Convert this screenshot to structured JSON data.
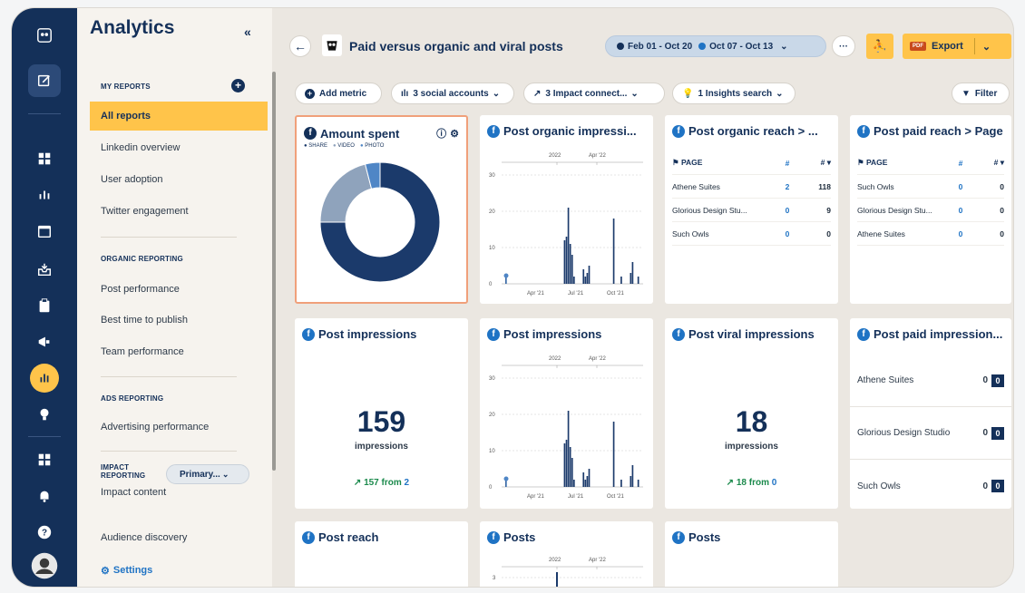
{
  "sidebar": {
    "title": "Analytics",
    "collapse": "«",
    "my_reports": "MY REPORTS",
    "items_my": [
      "All reports",
      "Linkedin overview",
      "User adoption",
      "Twitter engagement"
    ],
    "organic_h": "ORGANIC REPORTING",
    "items_organic": [
      "Post performance",
      "Best time to publish",
      "Team performance"
    ],
    "ads_h": "ADS REPORTING",
    "items_ads": [
      "Advertising performance"
    ],
    "impact_h1": "IMPACT",
    "impact_h2": "REPORTING",
    "impact_select": "Primary... ",
    "items_impact": [
      "Impact content",
      "Audience discovery"
    ],
    "settings": "Settings"
  },
  "header": {
    "title": "Paid versus organic and viral posts",
    "date_range": "Feb 01 - Oct 20",
    "compare_range": "Oct 07 - Oct 13",
    "more": "···",
    "export": "Export",
    "pdf_badge": "PDF"
  },
  "toolbar": {
    "add_metric": "Add metric",
    "social": "3 social accounts",
    "impact": "3 Impact connect...",
    "insights": "1 Insights search",
    "filter": "Filter"
  },
  "cards": {
    "amount_spent": {
      "title": "Amount spent",
      "legend": [
        "SHARE",
        "VIDEO",
        "PHOTO"
      ]
    },
    "organic_impr": {
      "title": "Post organic impressi..."
    },
    "organic_reach": {
      "title": "Post organic reach > ...",
      "col_page": "PAGE",
      "col_a": "#",
      "col_b": "#",
      "rows": [
        {
          "name": "Athene Suites",
          "a": "2",
          "b": "118"
        },
        {
          "name": "Glorious Design Stu...",
          "a": "0",
          "b": "9"
        },
        {
          "name": "Such Owls",
          "a": "0",
          "b": "0"
        }
      ]
    },
    "paid_reach": {
      "title": "Post paid reach > Page",
      "col_page": "PAGE",
      "col_a": "#",
      "col_b": "#",
      "rows": [
        {
          "name": "Such Owls",
          "a": "0",
          "b": "0"
        },
        {
          "name": "Glorious Design Stu...",
          "a": "0",
          "b": "0"
        },
        {
          "name": "Athene Suites",
          "a": "0",
          "b": "0"
        }
      ]
    },
    "post_impr": {
      "title": "Post impressions",
      "value": "159",
      "unit": "impressions",
      "delta": "157",
      "from_word": "from",
      "from": "2"
    },
    "post_impr_chart": {
      "title": "Post impressions"
    },
    "viral_impr": {
      "title": "Post viral impressions",
      "value": "18",
      "unit": "impressions",
      "delta": "18",
      "from_word": "from",
      "from": "0"
    },
    "paid_impr": {
      "title": "Post paid impression...",
      "rows": [
        {
          "name": "Athene Suites",
          "v": "0",
          "box": "0"
        },
        {
          "name": "Glorious Design Studio",
          "v": "0",
          "box": "0"
        },
        {
          "name": "Such Owls",
          "v": "0",
          "box": "0"
        }
      ]
    },
    "post_reach": {
      "title": "Post reach"
    },
    "posts_chart": {
      "title": "Posts"
    },
    "posts": {
      "title": "Posts"
    }
  },
  "chart_axes": {
    "yticks": [
      "30",
      "20",
      "10",
      "0"
    ],
    "xticks": [
      "Apr '21",
      "Jul '21",
      "Oct '21"
    ],
    "top_marks": [
      "2022",
      "Apr '22"
    ],
    "posts_y": "3"
  },
  "chart_data": [
    {
      "type": "pie",
      "title": "Amount spent",
      "labels": [
        "SHARE",
        "VIDEO",
        "PHOTO"
      ],
      "values": [
        75,
        21,
        4
      ],
      "colors": [
        "#1b3a6b",
        "#8fa3bc",
        "#4f86c6"
      ]
    },
    {
      "type": "bar",
      "title": "Post organic impressi...",
      "ylim": [
        0,
        30
      ],
      "values": [
        2,
        0,
        0,
        0,
        0,
        0,
        0,
        0,
        0,
        0,
        0,
        0,
        0,
        0,
        0,
        0,
        0,
        0,
        0,
        0,
        0,
        0,
        0,
        0,
        0,
        0,
        0,
        0,
        0,
        0,
        0,
        12,
        13,
        21,
        11,
        8,
        2,
        0,
        0,
        0,
        0,
        4,
        2,
        3,
        5,
        0,
        0,
        0,
        0,
        0,
        0,
        0,
        0,
        0,
        0,
        0,
        0,
        18,
        0,
        0,
        0,
        2,
        0,
        0,
        0,
        0,
        3,
        6,
        0,
        0,
        2,
        0
      ]
    },
    {
      "type": "bar",
      "title": "Post impressions",
      "ylim": [
        0,
        30
      ],
      "values": [
        2,
        0,
        0,
        0,
        0,
        0,
        0,
        0,
        0,
        0,
        0,
        0,
        0,
        0,
        0,
        0,
        0,
        0,
        0,
        0,
        0,
        0,
        0,
        0,
        0,
        0,
        0,
        0,
        0,
        0,
        0,
        12,
        13,
        21,
        11,
        8,
        2,
        0,
        0,
        0,
        0,
        4,
        2,
        3,
        5,
        0,
        0,
        0,
        0,
        0,
        0,
        0,
        0,
        0,
        0,
        0,
        0,
        18,
        0,
        0,
        0,
        2,
        0,
        0,
        0,
        0,
        3,
        6,
        0,
        0,
        2,
        0
      ]
    }
  ],
  "colors": {
    "navy": "#143059",
    "yellow": "#ffc44a",
    "blue": "#1f73c4",
    "orange": "#f0a07a"
  }
}
